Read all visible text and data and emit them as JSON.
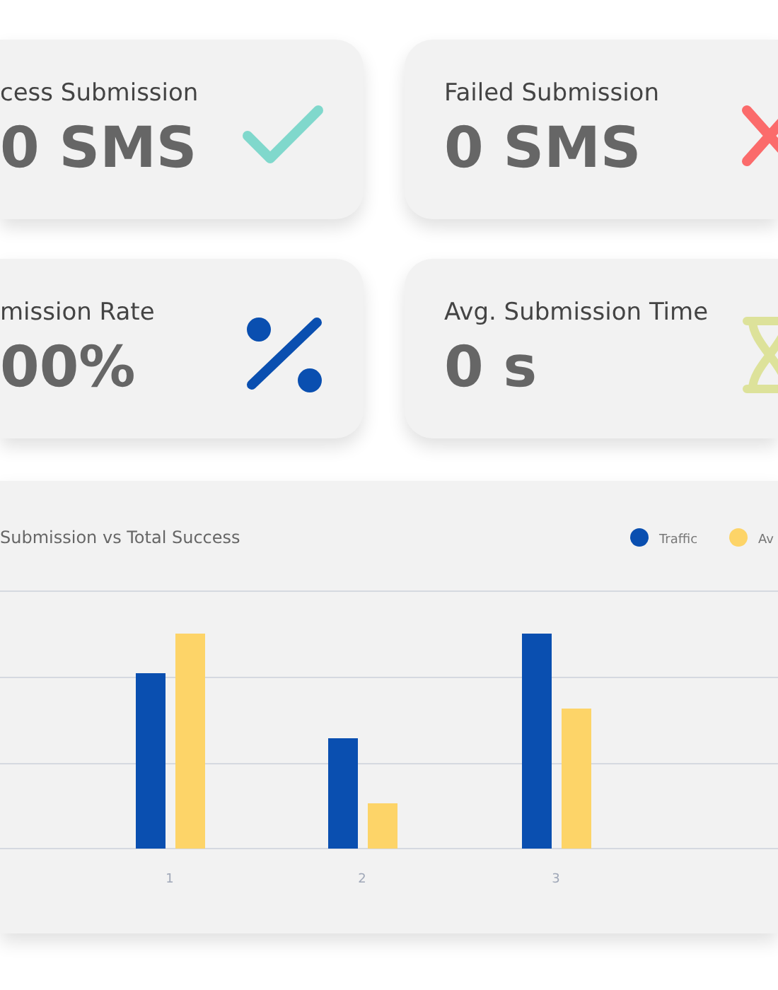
{
  "cards": [
    {
      "kind": "check",
      "title": "cess Submission",
      "value": "0 SMS"
    },
    {
      "kind": "cross",
      "title": "Failed Submission",
      "value": "0 SMS"
    },
    {
      "kind": "percent",
      "title": "mission Rate",
      "value": "00%"
    },
    {
      "kind": "hourglass",
      "title": "Avg. Submission Time",
      "value": "0 s"
    }
  ],
  "chart": {
    "title": "Submission vs Total Success",
    "legend": [
      {
        "label": "Traffic",
        "color": "#0a4fb0"
      },
      {
        "label": "Av",
        "color": "#fdd468"
      }
    ],
    "x_labels": [
      "1",
      "2",
      "3"
    ]
  }
}
